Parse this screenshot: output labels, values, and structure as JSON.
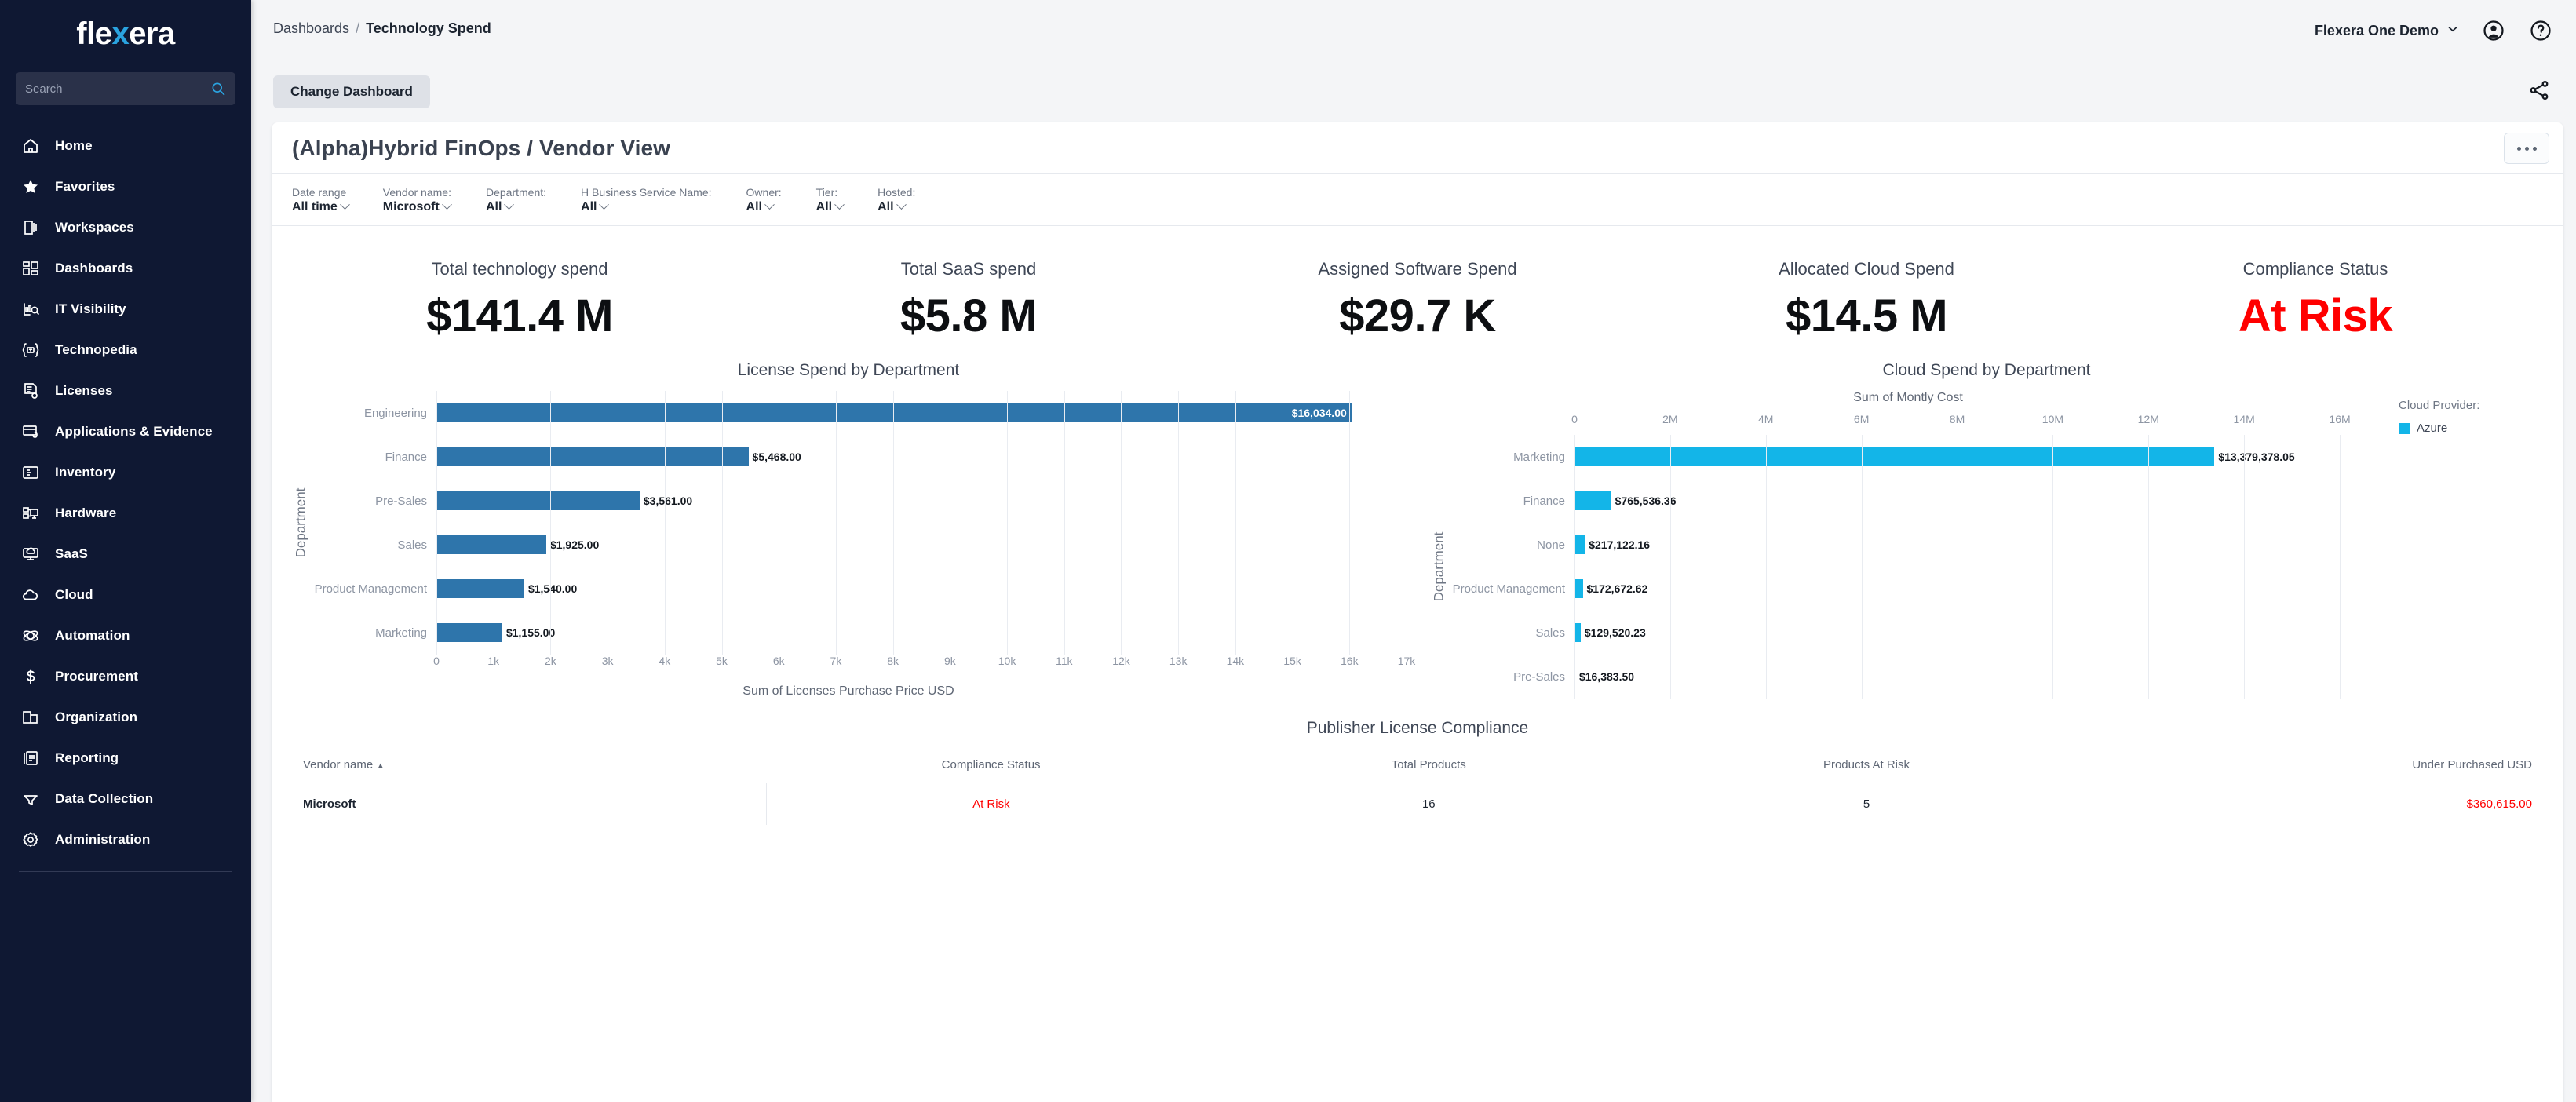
{
  "sidebar": {
    "logo": {
      "part1": "fle",
      "part2": "x",
      "part3": "era"
    },
    "search_placeholder": "Search",
    "items": [
      {
        "label": "Home",
        "icon": "home-icon"
      },
      {
        "label": "Favorites",
        "icon": "star-icon"
      },
      {
        "label": "Workspaces",
        "icon": "workspaces-icon"
      },
      {
        "label": "Dashboards",
        "icon": "dashboards-icon"
      },
      {
        "label": "IT Visibility",
        "icon": "it-visibility-icon"
      },
      {
        "label": "Technopedia",
        "icon": "technopedia-icon"
      },
      {
        "label": "Licenses",
        "icon": "licenses-icon"
      },
      {
        "label": "Applications & Evidence",
        "icon": "applications-evidence-icon"
      },
      {
        "label": "Inventory",
        "icon": "inventory-icon"
      },
      {
        "label": "Hardware",
        "icon": "hardware-icon"
      },
      {
        "label": "SaaS",
        "icon": "saas-icon"
      },
      {
        "label": "Cloud",
        "icon": "cloud-icon"
      },
      {
        "label": "Automation",
        "icon": "automation-icon"
      },
      {
        "label": "Procurement",
        "icon": "procurement-icon"
      },
      {
        "label": "Organization",
        "icon": "organization-icon"
      },
      {
        "label": "Reporting",
        "icon": "reporting-icon"
      },
      {
        "label": "Data Collection",
        "icon": "data-collection-icon"
      },
      {
        "label": "Administration",
        "icon": "administration-icon"
      }
    ]
  },
  "topbar": {
    "breadcrumb_root": "Dashboards",
    "breadcrumb_sep": "/",
    "breadcrumb_current": "Technology Spend",
    "tenant": "Flexera One Demo",
    "account_icon": "account-circle-icon",
    "help_icon": "help-circle-icon",
    "share_icon": "share-icon"
  },
  "subbar": {
    "change_dashboard": "Change Dashboard"
  },
  "dashboard": {
    "title": "(Alpha)Hybrid FinOps / Vendor View",
    "kebab_icon": "more-options-icon",
    "filters": [
      {
        "label": "Date range",
        "value": "All time"
      },
      {
        "label": "Vendor name:",
        "value": "Microsoft"
      },
      {
        "label": "Department:",
        "value": "All"
      },
      {
        "label": "H Business Service Name:",
        "value": "All"
      },
      {
        "label": "Owner:",
        "value": "All"
      },
      {
        "label": "Tier:",
        "value": "All"
      },
      {
        "label": "Hosted:",
        "value": "All"
      }
    ],
    "kpis": [
      {
        "label": "Total technology spend",
        "value": "$141.4 M",
        "risk": false
      },
      {
        "label": "Total SaaS spend",
        "value": "$5.8 M",
        "risk": false
      },
      {
        "label": "Assigned Software Spend",
        "value": "$29.7 K",
        "risk": false
      },
      {
        "label": "Allocated Cloud Spend",
        "value": "$14.5 M",
        "risk": false
      },
      {
        "label": "Compliance Status",
        "value": "At Risk",
        "risk": true
      }
    ]
  },
  "chart_data": [
    {
      "type": "bar",
      "orientation": "horizontal",
      "title": "License Spend by Department",
      "xlabel": "Sum of Licenses Purchase Price USD",
      "ylabel": "Department",
      "categories": [
        "Engineering",
        "Finance",
        "Pre-Sales",
        "Sales",
        "Product Management",
        "Marketing"
      ],
      "values": [
        16034.0,
        5468.0,
        3561.0,
        1925.0,
        1540.0,
        1155.0
      ],
      "value_labels": [
        "$16,034.00",
        "$5,468.00",
        "$3,561.00",
        "$1,925.00",
        "$1,540.00",
        "$1,155.00"
      ],
      "label_inside": [
        true,
        false,
        false,
        false,
        false,
        false
      ],
      "xlim": [
        0,
        17000
      ],
      "xticks": [
        "0",
        "1k",
        "2k",
        "3k",
        "4k",
        "5k",
        "6k",
        "7k",
        "8k",
        "9k",
        "10k",
        "11k",
        "12k",
        "13k",
        "14k",
        "15k",
        "16k",
        "17k"
      ],
      "xtick_values": [
        0,
        1000,
        2000,
        3000,
        4000,
        5000,
        6000,
        7000,
        8000,
        9000,
        10000,
        11000,
        12000,
        13000,
        14000,
        15000,
        16000,
        17000
      ],
      "color": "#2e75ab",
      "grid": true,
      "legend": null
    },
    {
      "type": "bar",
      "orientation": "horizontal",
      "title": "Cloud Spend by Department",
      "xlabel": "Sum of Montly Cost",
      "ylabel": "Department",
      "axis_position": "top",
      "categories": [
        "Marketing",
        "Finance",
        "None",
        "Product Management",
        "Sales",
        "Pre-Sales"
      ],
      "values": [
        13379378.05,
        765536.36,
        217122.16,
        172672.62,
        129520.23,
        16383.5
      ],
      "value_labels": [
        "$13,379,378.05",
        "$765,536.36",
        "$217,122.16",
        "$172,672.62",
        "$129,520.23",
        "$16,383.50"
      ],
      "label_inside": [
        false,
        false,
        false,
        false,
        false,
        false
      ],
      "xlim": [
        0,
        17000000
      ],
      "xticks": [
        "0",
        "2M",
        "4M",
        "6M",
        "8M",
        "10M",
        "12M",
        "14M",
        "16M"
      ],
      "xtick_values": [
        0,
        2000000,
        4000000,
        6000000,
        8000000,
        10000000,
        12000000,
        14000000,
        16000000
      ],
      "color": "#13b5e8",
      "grid": true,
      "legend": {
        "title": "Cloud Provider:",
        "entries": [
          {
            "label": "Azure",
            "color": "#13b5e8"
          }
        ],
        "position": "right"
      }
    }
  ],
  "table": {
    "title": "Publisher License Compliance",
    "sort_indicator": "▲",
    "columns": [
      {
        "label": "Vendor name",
        "align": "l",
        "sorted": true
      },
      {
        "label": "Compliance Status",
        "align": "c",
        "sorted": false
      },
      {
        "label": "Total Products",
        "align": "c",
        "sorted": false
      },
      {
        "label": "Products At Risk",
        "align": "c",
        "sorted": false
      },
      {
        "label": "Under Purchased USD",
        "align": "r",
        "sorted": false
      }
    ],
    "rows": [
      {
        "vendor": "Microsoft",
        "compliance_status": "At Risk",
        "total_products": "16",
        "products_at_risk": "5",
        "under_purchased": "$360,615.00"
      }
    ]
  },
  "colors": {
    "sidebar_bg": "#0f1833",
    "brand_blue": "#2aa3e0",
    "license_bar": "#2e75ab",
    "cloud_bar": "#13b5e8",
    "risk_red": "#ff0000"
  }
}
